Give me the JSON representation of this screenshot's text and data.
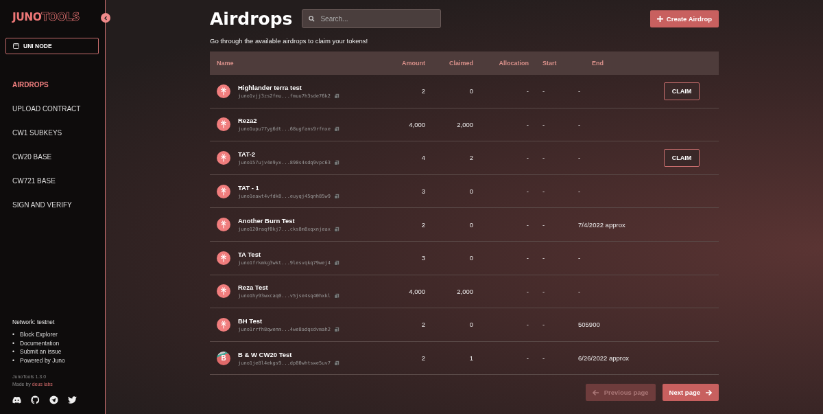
{
  "sidebar": {
    "logo": {
      "bold": "JUNO",
      "outline": "TOOLS"
    },
    "node_button": "UNI NODE",
    "nav": [
      {
        "label": "AIRDROPS",
        "selected": true
      },
      {
        "label": "UPLOAD CONTRACT",
        "selected": false
      },
      {
        "label": "CW1 SUBKEYS",
        "selected": false
      },
      {
        "label": "CW20 BASE",
        "selected": false
      },
      {
        "label": "CW721 BASE",
        "selected": false
      },
      {
        "label": "SIGN AND VERIFY",
        "selected": false
      }
    ],
    "network": "Network: testnet",
    "links": [
      {
        "marker": "•",
        "label": "Block Explorer"
      },
      {
        "marker": "•",
        "label": "Documentation"
      },
      {
        "marker": "•",
        "label": "Submit an issue"
      },
      {
        "marker": "•",
        "label": "Powered by Juno"
      }
    ],
    "version": "JunoTools 1.3.0",
    "made_by": "Made by",
    "made_by_link": "deus labs"
  },
  "header": {
    "title": "Airdrops",
    "search": {
      "placeholder": "Search..."
    },
    "create_button": "Create Airdrop",
    "subtitle": "Go through the available airdrops to claim your tokens!"
  },
  "table": {
    "columns": [
      "Name",
      "Amount",
      "Claimed",
      "Allocation",
      "Start",
      "End"
    ],
    "rows": [
      {
        "name": "Highlander terra test",
        "address": "juno1vjj3zs2fmu...fmuu7h3sde76k2",
        "amount": "2",
        "claimed": "0",
        "allocation": "-",
        "start": "-",
        "end": "-",
        "avatar": {
          "kind": "logo"
        },
        "claim": "CLAIM"
      },
      {
        "name": "Reza2",
        "address": "juno1upu77yg6dt...68ugfans9rfnxe",
        "amount": "4,000",
        "claimed": "2,000",
        "allocation": "-",
        "start": "-",
        "end": "-",
        "avatar": {
          "kind": "logo"
        }
      },
      {
        "name": "TAT-2",
        "address": "juno157ujv4e9yx...890s4sdq9vpc63",
        "amount": "4",
        "claimed": "2",
        "allocation": "-",
        "start": "-",
        "end": "-",
        "avatar": {
          "kind": "logo"
        },
        "claim": "CLAIM"
      },
      {
        "name": "TAT - 1",
        "address": "juno1eawt4vfdk8...euyqj45qnh85w9",
        "amount": "3",
        "claimed": "0",
        "allocation": "-",
        "start": "-",
        "end": "-",
        "avatar": {
          "kind": "logo"
        }
      },
      {
        "name": "Another Burn Test",
        "address": "juno120raqf0kj7...cks8m8xqxnjeax",
        "amount": "2",
        "claimed": "0",
        "allocation": "-",
        "start": "-",
        "end": "7/4/2022 approx",
        "avatar": {
          "kind": "logo"
        }
      },
      {
        "name": "TA Test",
        "address": "juno1frkmkg3wkt...9lesvqkq79wej4",
        "amount": "3",
        "claimed": "0",
        "allocation": "-",
        "start": "-",
        "end": "-",
        "avatar": {
          "kind": "logo"
        }
      },
      {
        "name": "Reza Test",
        "address": "juno1hy93wxcaq0...v5jse4sq40hxkl",
        "amount": "4,000",
        "claimed": "2,000",
        "allocation": "-",
        "start": "-",
        "end": "-",
        "avatar": {
          "kind": "logo"
        }
      },
      {
        "name": "BH Test",
        "address": "juno1rrfh8qwenm...4we8adqsdvmah2",
        "amount": "2",
        "claimed": "0",
        "allocation": "-",
        "start": "-",
        "end": "505900",
        "avatar": {
          "kind": "logo"
        }
      },
      {
        "name": "B & W CW20 Test",
        "address": "juno1je8l4ekgs9...dp00whtswe5uv7",
        "amount": "2",
        "claimed": "1",
        "allocation": "-",
        "start": "-",
        "end": "6/26/2022 approx",
        "avatar": {
          "kind": "letter",
          "letter": "B"
        }
      }
    ]
  },
  "pagination": {
    "previous": {
      "label": "Previous page",
      "disabled": true
    },
    "next": {
      "label": "Next page",
      "disabled": false
    }
  }
}
